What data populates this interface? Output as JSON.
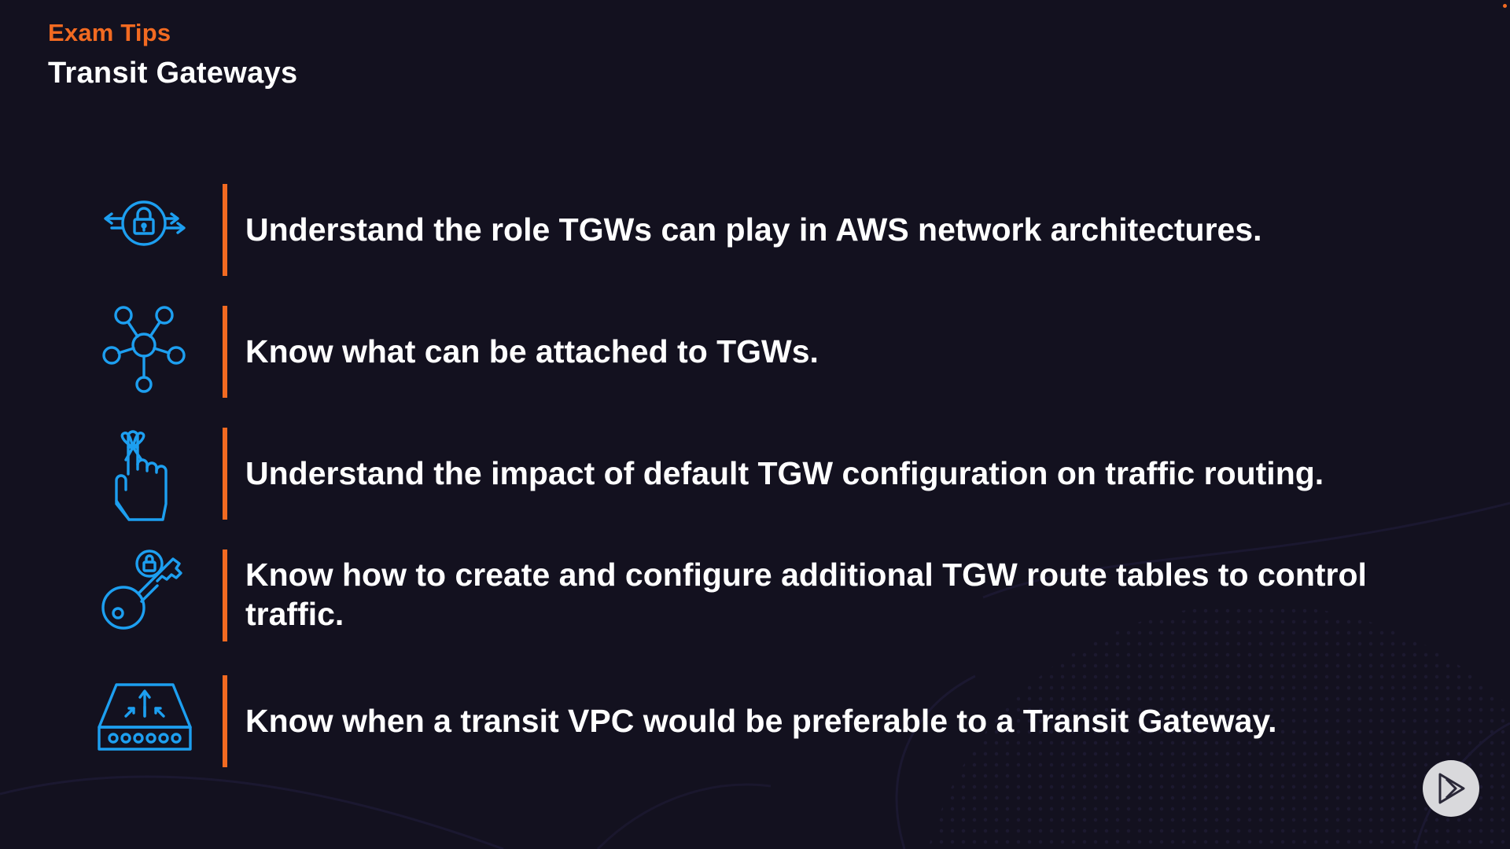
{
  "header": {
    "eyebrow": "Exam Tips",
    "title": "Transit Gateways"
  },
  "colors": {
    "background": "#13111f",
    "accent_orange": "#f26a21",
    "icon_blue": "#1d9ff0",
    "text": "#ffffff"
  },
  "tips": [
    {
      "icon": "lock-arrows-icon",
      "text": "Understand the role TGWs can play in AWS network architectures."
    },
    {
      "icon": "network-hub-icon",
      "text": "Know what can be attached to TGWs."
    },
    {
      "icon": "finger-ribbon-icon",
      "text": "Understand the impact of default TGW configuration on traffic routing."
    },
    {
      "icon": "key-lock-icon",
      "text": "Know how to create and configure additional TGW route tables to control traffic."
    },
    {
      "icon": "gateway-device-icon",
      "text": "Know when a transit VPC would be preferable to a Transit Gateway."
    }
  ],
  "player": {
    "icon": "play-logo-icon"
  }
}
